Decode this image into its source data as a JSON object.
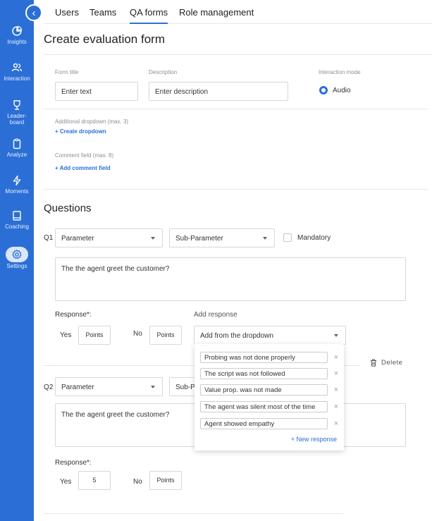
{
  "sidebar": {
    "items": [
      {
        "label": "Insights"
      },
      {
        "label": "Interaction"
      },
      {
        "label": "Leader-\nboard",
        "label_line1": "Leader-",
        "label_line2": "board"
      },
      {
        "label": "Analyze"
      },
      {
        "label": "Moments"
      },
      {
        "label": "Coaching"
      },
      {
        "label": "Settings"
      }
    ],
    "colors": {
      "background": "#2b6fd6",
      "active_pill": "#dbe6fb"
    }
  },
  "tabs": [
    {
      "label": "Users"
    },
    {
      "label": "Teams"
    },
    {
      "label": "QA forms",
      "active": true
    },
    {
      "label": "Role management"
    }
  ],
  "page": {
    "title": "Create evaluation form"
  },
  "form": {
    "title_label": "Form title",
    "title_placeholder": "Enter text",
    "description_label": "Description",
    "description_placeholder": "Enter description",
    "interaction_mode_label": "Interaction mode",
    "interaction_mode_value": "Audio",
    "additional_dropdown_label": "Additional dropdown (max. 3)",
    "create_dropdown_link": "+ Create dropdown",
    "comment_field_label": "Comment field (max. 8)",
    "add_comment_link": "+ Add comment field"
  },
  "questions_title": "Questions",
  "q1": {
    "number": "Q1",
    "parameter": "Parameter",
    "sub_parameter": "Sub-Parameter",
    "mandatory_label": "Mandatory",
    "text": "The the agent greet the customer?",
    "response_label": "Response*:",
    "yes_label": "Yes",
    "yes_points": "Points",
    "no_label": "No",
    "no_points": "Points",
    "add_response_label": "Add response",
    "add_response_select": "Add from the dropdown"
  },
  "dropdown_menu": {
    "options": [
      "Probing was not done properly",
      "The script was not followed",
      "Value prop. was not made",
      "The agent was silent most of the time",
      "Agent showed empathy"
    ],
    "new_response": "+ New response"
  },
  "delete_label": "Delete",
  "q2": {
    "number": "Q2",
    "parameter": "Parameter",
    "sub_parameter": "Sub-Parameter",
    "text": "The the agent greet the customer?",
    "response_label": "Response*:",
    "yes_label": "Yes",
    "yes_points": "5",
    "no_label": "No",
    "no_points": "Points"
  },
  "accent_color": "#2b6fd6"
}
